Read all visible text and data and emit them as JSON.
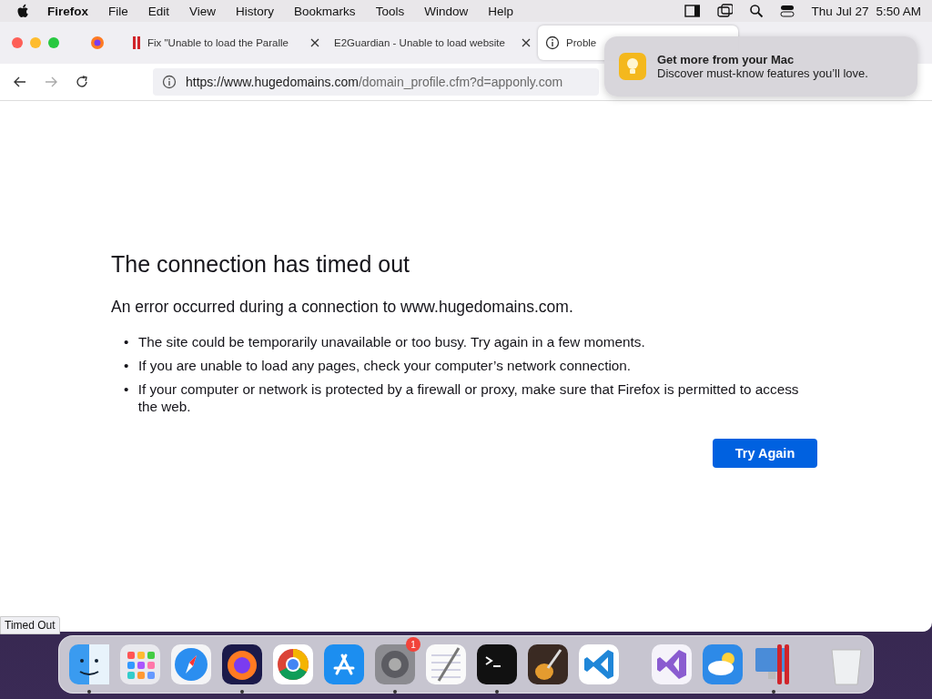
{
  "menu_bar": {
    "app": "Firefox",
    "items": [
      "File",
      "Edit",
      "View",
      "History",
      "Bookmarks",
      "Tools",
      "Window",
      "Help"
    ],
    "date": "Thu Jul 27",
    "time": "5:50 AM"
  },
  "tabs": [
    {
      "kind": "pinned",
      "selected": false
    },
    {
      "kind": "page",
      "label": "Fix \"Unable to load the Paralle",
      "selected": false
    },
    {
      "kind": "page",
      "label": "E2Guardian - Unable to load website",
      "selected": false
    },
    {
      "kind": "info",
      "label": "Proble",
      "selected": true
    }
  ],
  "address_bar": {
    "host": "https://www.hugedomains.com",
    "path": "/domain_profile.cfm?d=apponly.com"
  },
  "notification": {
    "title": "Get more from your Mac",
    "body": "Discover must-know features you’ll love."
  },
  "error_page": {
    "title": "The connection has timed out",
    "description": "An error occurred during a connection to www.hugedomains.com.",
    "bullets": [
      {
        "marker": "•",
        "text": "The site could be temporarily unavailable or too busy. Try again in a few moments."
      },
      {
        "marker": "•",
        "text": "If you are unable to load any pages, check your computer’s network connection."
      },
      {
        "marker": "•",
        "text": "If your computer or network is protected by a firewall or proxy, make sure that Firefox is permitted to access the web."
      }
    ],
    "button": "Try Again"
  },
  "status": "Timed Out",
  "dock_groups": [
    [
      {
        "running": true
      },
      {
        "running": false
      },
      {
        "running": false
      },
      {
        "running": true
      },
      {
        "running": false
      },
      {
        "running": false
      },
      {
        "running": true,
        "badge": "1"
      },
      {
        "running": false
      },
      {
        "running": true
      },
      {
        "running": false
      },
      {
        "running": false
      }
    ],
    [
      {
        "running": false
      },
      {
        "running": false
      },
      {
        "running": true
      }
    ],
    [
      {
        "running": false
      }
    ]
  ]
}
